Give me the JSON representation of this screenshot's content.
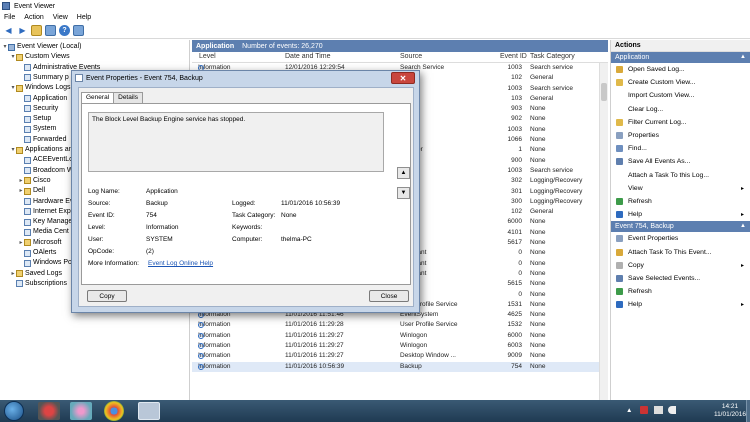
{
  "window": {
    "title": "Event Viewer"
  },
  "menu": [
    "File",
    "Action",
    "View",
    "Help"
  ],
  "tree": [
    {
      "label": "Event Viewer (Local)",
      "lvl": 0,
      "icon": "root",
      "arrow": "▾"
    },
    {
      "label": "Custom Views",
      "lvl": 1,
      "icon": "fld",
      "arrow": "▾"
    },
    {
      "label": "Administrative Events",
      "lvl": 2,
      "icon": "log",
      "arrow": ""
    },
    {
      "label": "Summary p",
      "lvl": 2,
      "icon": "log",
      "arrow": ""
    },
    {
      "label": "Windows Logs",
      "lvl": 1,
      "icon": "fld",
      "arrow": "▾"
    },
    {
      "label": "Application",
      "lvl": 2,
      "icon": "log",
      "arrow": ""
    },
    {
      "label": "Security",
      "lvl": 2,
      "icon": "log",
      "arrow": ""
    },
    {
      "label": "Setup",
      "lvl": 2,
      "icon": "log",
      "arrow": ""
    },
    {
      "label": "System",
      "lvl": 2,
      "icon": "log",
      "arrow": ""
    },
    {
      "label": "Forwarded",
      "lvl": 2,
      "icon": "log",
      "arrow": ""
    },
    {
      "label": "Applications an",
      "lvl": 1,
      "icon": "fld",
      "arrow": "▾"
    },
    {
      "label": "ACEEventLo",
      "lvl": 2,
      "icon": "log",
      "arrow": ""
    },
    {
      "label": "Broadcom W",
      "lvl": 2,
      "icon": "log",
      "arrow": ""
    },
    {
      "label": "Cisco",
      "lvl": 2,
      "icon": "fld",
      "arrow": "▸"
    },
    {
      "label": "Dell",
      "lvl": 2,
      "icon": "fld",
      "arrow": "▸"
    },
    {
      "label": "Hardware Ev",
      "lvl": 2,
      "icon": "log",
      "arrow": ""
    },
    {
      "label": "Internet Exp",
      "lvl": 2,
      "icon": "log",
      "arrow": ""
    },
    {
      "label": "Key Manage",
      "lvl": 2,
      "icon": "log",
      "arrow": ""
    },
    {
      "label": "Media Cent",
      "lvl": 2,
      "icon": "log",
      "arrow": ""
    },
    {
      "label": "Microsoft",
      "lvl": 2,
      "icon": "fld",
      "arrow": "▸"
    },
    {
      "label": "OAlerts",
      "lvl": 2,
      "icon": "log",
      "arrow": ""
    },
    {
      "label": "Windows Po",
      "lvl": 2,
      "icon": "log",
      "arrow": ""
    },
    {
      "label": "Saved Logs",
      "lvl": 1,
      "icon": "fld",
      "arrow": "▸"
    },
    {
      "label": "Subscriptions",
      "lvl": 1,
      "icon": "log",
      "arrow": ""
    }
  ],
  "middle": {
    "title": "Application",
    "count_label": "Number of events: 26,270"
  },
  "columns": [
    "Level",
    "Date and Time",
    "Source",
    "Event ID",
    "Task Category"
  ],
  "events": [
    {
      "level": "Information",
      "date": "12/01/2016 12:29:54",
      "source": "Search Service",
      "id": "1003",
      "cat": "Search service"
    },
    {
      "level": "",
      "date": "",
      "source": "",
      "id": "102",
      "cat": "General"
    },
    {
      "level": "",
      "date": "",
      "source": "",
      "id": "1003",
      "cat": "Search service"
    },
    {
      "level": "",
      "date": "",
      "source": "",
      "id": "103",
      "cat": "General"
    },
    {
      "level": "",
      "date": "",
      "source": "y-SPP",
      "id": "903",
      "cat": "None"
    },
    {
      "level": "",
      "date": "",
      "source": "y-SPP",
      "id": "902",
      "cat": "None"
    },
    {
      "level": "",
      "date": "",
      "source": "y-SPP",
      "id": "1003",
      "cat": "None"
    },
    {
      "level": "",
      "date": "",
      "source": "y-SPP",
      "id": "1066",
      "cat": "None"
    },
    {
      "level": "",
      "date": "",
      "source": "yCenter",
      "id": "1",
      "cat": "None"
    },
    {
      "level": "",
      "date": "",
      "source": "y-SPP",
      "id": "900",
      "cat": "None"
    },
    {
      "level": "",
      "date": "",
      "source": "",
      "id": "1003",
      "cat": "Search service"
    },
    {
      "level": "",
      "date": "",
      "source": "",
      "id": "302",
      "cat": "Logging/Recovery"
    },
    {
      "level": "",
      "date": "",
      "source": "",
      "id": "301",
      "cat": "Logging/Recovery"
    },
    {
      "level": "",
      "date": "",
      "source": "",
      "id": "300",
      "cat": "Logging/Recovery"
    },
    {
      "level": "",
      "date": "",
      "source": "",
      "id": "102",
      "cat": "General"
    },
    {
      "level": "",
      "date": "",
      "source": "tion",
      "id": "6000",
      "cat": "None"
    },
    {
      "level": "",
      "date": "",
      "source": "tion",
      "id": "4101",
      "cat": "None"
    },
    {
      "level": "",
      "date": "",
      "source": "",
      "id": "5617",
      "cat": "None"
    },
    {
      "level": "",
      "date": "",
      "source": "Assistant",
      "id": "0",
      "cat": "None"
    },
    {
      "level": "",
      "date": "",
      "source": "Assistant",
      "id": "0",
      "cat": "None"
    },
    {
      "level": "",
      "date": "",
      "source": "Assistant",
      "id": "0",
      "cat": "None"
    },
    {
      "level": "",
      "date": "",
      "source": "",
      "id": "5615",
      "cat": "None"
    },
    {
      "level": "",
      "date": "",
      "source": "",
      "id": "0",
      "cat": "None"
    },
    {
      "level": "Information",
      "date": "11/01/2016 11:51:46",
      "source": "User Profile Service",
      "id": "1531",
      "cat": "None"
    },
    {
      "level": "Information",
      "date": "11/01/2016 11:51:46",
      "source": "EventSystem",
      "id": "4625",
      "cat": "None"
    },
    {
      "level": "Information",
      "date": "11/01/2016 11:29:28",
      "source": "User Profile Service",
      "id": "1532",
      "cat": "None"
    },
    {
      "level": "Information",
      "date": "11/01/2016 11:29:27",
      "source": "Winlogon",
      "id": "6000",
      "cat": "None"
    },
    {
      "level": "Information",
      "date": "11/01/2016 11:29:27",
      "source": "Winlogon",
      "id": "6003",
      "cat": "None"
    },
    {
      "level": "Information",
      "date": "11/01/2016 11:29:27",
      "source": "Desktop Window ...",
      "id": "9009",
      "cat": "None"
    },
    {
      "level": "Information",
      "date": "11/01/2016 10:56:39",
      "source": "Backup",
      "id": "754",
      "cat": "None"
    }
  ],
  "actions": {
    "header": "Actions",
    "section1": "Application",
    "items1": [
      {
        "label": "Open Saved Log...",
        "icon": "#d9a93a",
        "chev": ""
      },
      {
        "label": "Create Custom View...",
        "icon": "#e0b94a",
        "chev": ""
      },
      {
        "label": "Import Custom View...",
        "icon": "",
        "chev": ""
      },
      {
        "label": "Clear Log...",
        "icon": "",
        "chev": ""
      },
      {
        "label": "Filter Current Log...",
        "icon": "#e0b94a",
        "chev": ""
      },
      {
        "label": "Properties",
        "icon": "#8aa0c0",
        "chev": ""
      },
      {
        "label": "Find...",
        "icon": "#6e8fbf",
        "chev": ""
      },
      {
        "label": "Save All Events As...",
        "icon": "#5f7fae",
        "chev": ""
      },
      {
        "label": "Attach a Task To this Log...",
        "icon": "",
        "chev": ""
      },
      {
        "label": "View",
        "icon": "",
        "chev": "▸"
      },
      {
        "label": "Refresh",
        "icon": "#3d9b4a",
        "chev": ""
      },
      {
        "label": "Help",
        "icon": "#2e6bbf",
        "chev": "▸"
      }
    ],
    "section2": "Event 754, Backup",
    "items2": [
      {
        "label": "Event Properties",
        "icon": "#8aa0c0",
        "chev": ""
      },
      {
        "label": "Attach Task To This Event...",
        "icon": "#d9a93a",
        "chev": ""
      },
      {
        "label": "Copy",
        "icon": "#b0b0b0",
        "chev": "▸"
      },
      {
        "label": "Save Selected Events...",
        "icon": "#5f7fae",
        "chev": ""
      },
      {
        "label": "Refresh",
        "icon": "#3d9b4a",
        "chev": ""
      },
      {
        "label": "Help",
        "icon": "#2e6bbf",
        "chev": "▸"
      }
    ]
  },
  "dialog": {
    "title": "Event Properties - Event 754, Backup",
    "tabs": [
      "General",
      "Details"
    ],
    "message": "The Block Level Backup Engine service has stopped.",
    "labels": {
      "log_name": "Log Name:",
      "source": "Source:",
      "event_id": "Event ID:",
      "level": "Level:",
      "user": "User:",
      "opcode": "OpCode:",
      "more_info": "More Information:",
      "logged": "Logged:",
      "task_category": "Task Category:",
      "keywords": "Keywords:",
      "computer": "Computer:"
    },
    "values": {
      "log_name": "Application",
      "source": "Backup",
      "event_id": "754",
      "level": "Information",
      "user": "SYSTEM",
      "opcode": "(2)",
      "more_info": "Event Log Online Help",
      "logged": "11/01/2016 10:56:39",
      "task_category": "None",
      "keywords": "",
      "computer": "thelma-PC"
    },
    "copy_label": "Copy",
    "close_label": "Close",
    "close_x": "✕"
  },
  "taskbar": {
    "time": "14:21",
    "date": "11/01/2016"
  }
}
